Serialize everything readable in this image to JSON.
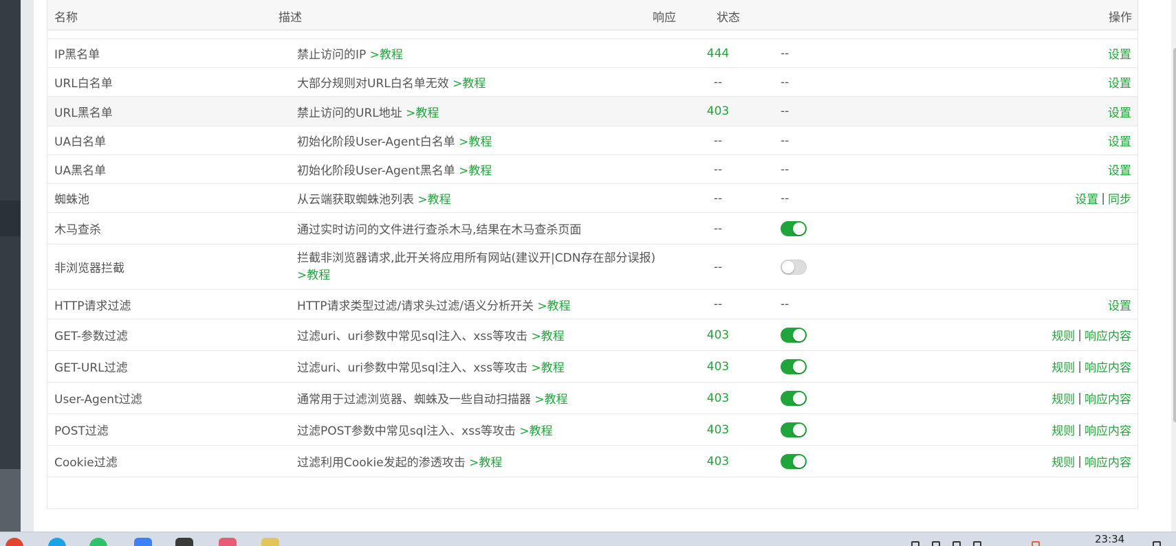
{
  "table": {
    "headers": {
      "name": "名称",
      "desc": "描述",
      "resp": "响应",
      "state": "状态",
      "action": "操作"
    },
    "rows": [
      {
        "name": "IP黑名单",
        "desc": "禁止访问的IP",
        "tutorial": ">教程",
        "resp": "444",
        "state": "--",
        "actions": [
          "设置"
        ]
      },
      {
        "name": "URL白名单",
        "desc": "大部分规则对URL白名单无效",
        "tutorial": ">教程",
        "resp": "--",
        "state": "--",
        "actions": [
          "设置"
        ]
      },
      {
        "name": "URL黑名单",
        "desc": "禁止访问的URL地址",
        "tutorial": ">教程",
        "resp": "403",
        "state": "--",
        "actions": [
          "设置"
        ]
      },
      {
        "name": "UA白名单",
        "desc": "初始化阶段User-Agent白名单",
        "tutorial": ">教程",
        "resp": "--",
        "state": "--",
        "actions": [
          "设置"
        ]
      },
      {
        "name": "UA黑名单",
        "desc": "初始化阶段User-Agent黑名单",
        "tutorial": ">教程",
        "resp": "--",
        "state": "--",
        "actions": [
          "设置"
        ]
      },
      {
        "name": "蜘蛛池",
        "desc": "从云端获取蜘蛛池列表",
        "tutorial": ">教程",
        "resp": "--",
        "state": "--",
        "actions": [
          "设置",
          "同步"
        ]
      },
      {
        "name": "木马查杀",
        "desc": "通过实时访问的文件进行查杀木马,结果在木马查杀页面",
        "tutorial": "",
        "resp": "--",
        "toggle": true,
        "actions": []
      },
      {
        "name": "非浏览器拦截",
        "desc": "拦截非浏览器请求,此开关将应用所有网站(建议开|CDN存在部分误报)",
        "tutorial": ">教程",
        "resp": "--",
        "toggle": false,
        "actions": []
      },
      {
        "name": "HTTP请求过滤",
        "desc": "HTTP请求类型过滤/请求头过滤/语义分析开关",
        "tutorial": ">教程",
        "resp": "--",
        "state": "--",
        "actions": [
          "设置"
        ]
      },
      {
        "name": "GET-参数过滤",
        "desc": "过滤uri、uri参数中常见sql注入、xss等攻击",
        "tutorial": ">教程",
        "resp": "403",
        "toggle": true,
        "actions": [
          "规则",
          "响应内容"
        ]
      },
      {
        "name": "GET-URL过滤",
        "desc": "过滤uri、uri参数中常见sql注入、xss等攻击",
        "tutorial": ">教程",
        "resp": "403",
        "toggle": true,
        "actions": [
          "规则",
          "响应内容"
        ]
      },
      {
        "name": "User-Agent过滤",
        "desc": "通常用于过滤浏览器、蜘蛛及一些自动扫描器",
        "tutorial": ">教程",
        "resp": "403",
        "toggle": true,
        "actions": [
          "规则",
          "响应内容"
        ]
      },
      {
        "name": "POST过滤",
        "desc": "过滤POST参数中常见sql注入、xss等攻击",
        "tutorial": ">教程",
        "resp": "403",
        "toggle": true,
        "actions": [
          "规则",
          "响应内容"
        ]
      },
      {
        "name": "Cookie过滤",
        "desc": "过滤利用Cookie发起的渗透攻击",
        "tutorial": ">教程",
        "resp": "403",
        "toggle": true,
        "actions": [
          "规则",
          "响应内容"
        ]
      }
    ]
  },
  "taskbar": {
    "time": "23:34"
  },
  "colors": {
    "accent": "#20a53a",
    "toggle_off": "#dddddd"
  }
}
